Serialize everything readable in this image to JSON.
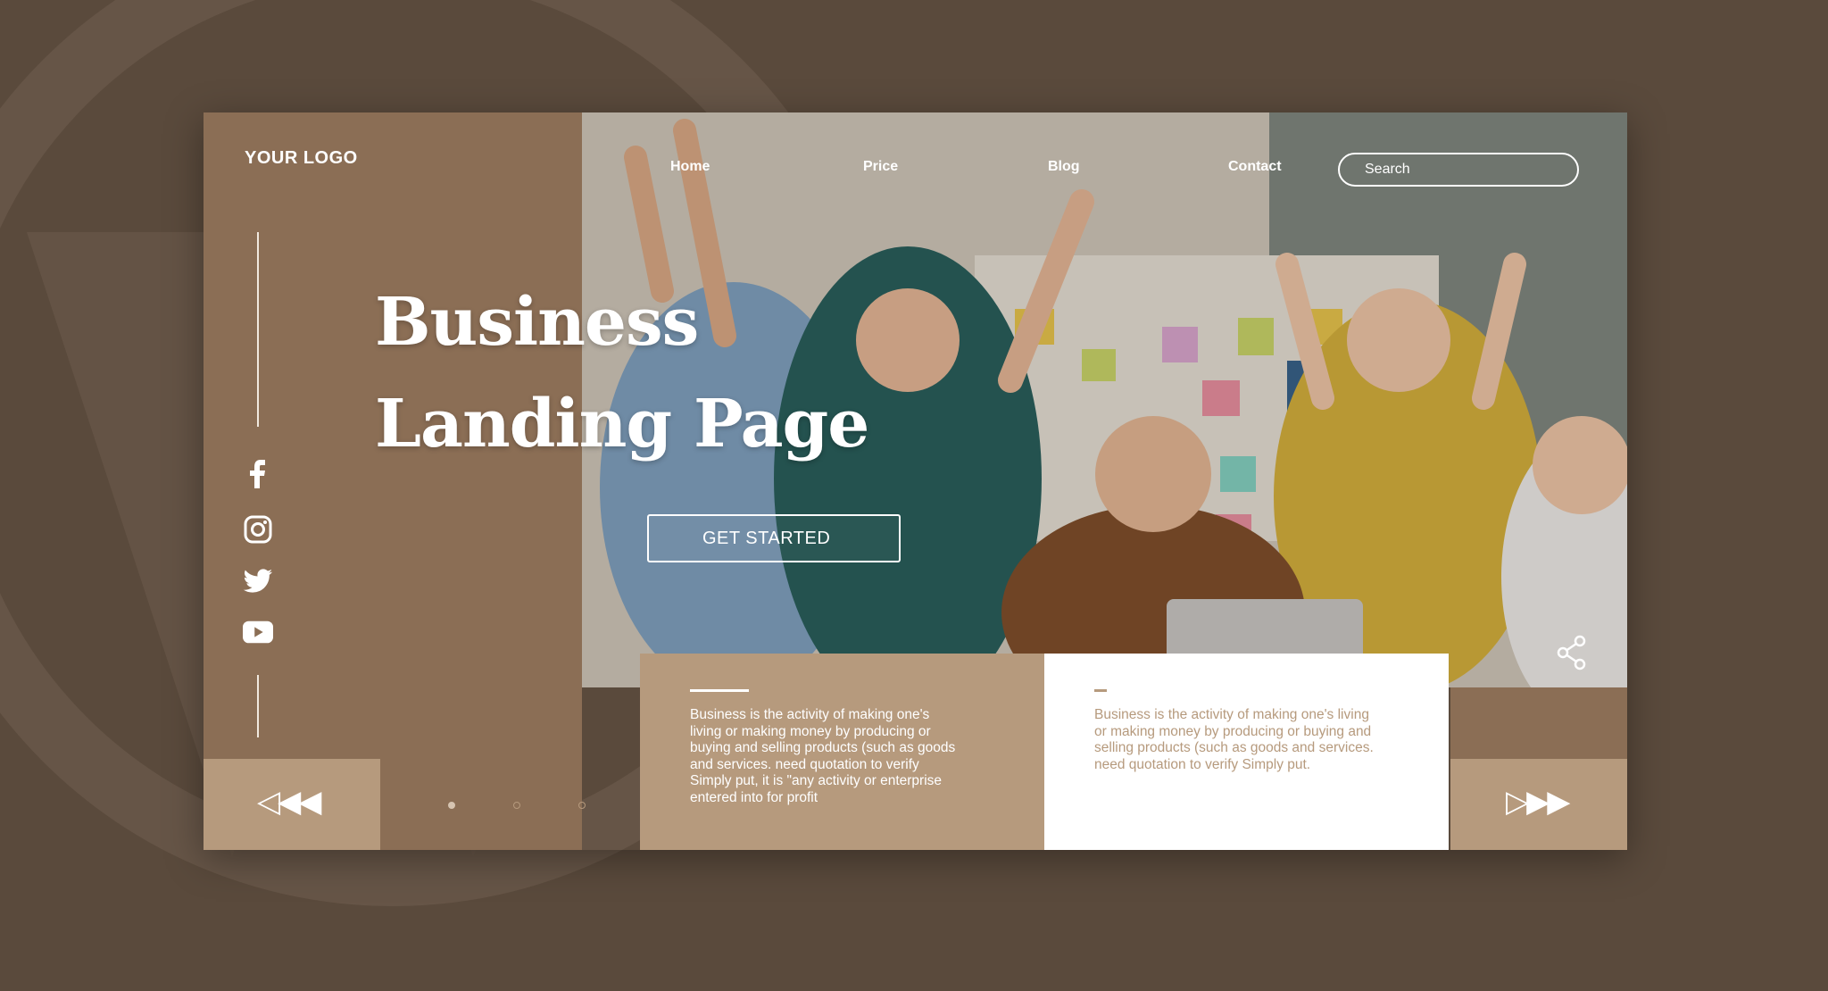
{
  "brand": {
    "logo": "YOUR LOGO"
  },
  "nav": {
    "home": "Home",
    "price": "Price",
    "blog": "Blog",
    "contact": "Contact"
  },
  "search": {
    "placeholder": "Search"
  },
  "hero": {
    "title_line1": "Business",
    "title_line2": "Landing Page",
    "cta": "GET STARTED"
  },
  "social": [
    "facebook-icon",
    "instagram-icon",
    "twitter-icon",
    "youtube-icon"
  ],
  "slider": {
    "prev": "◁◀◀",
    "next": "▷▶▶",
    "dots": 3
  },
  "cards": [
    {
      "text": "Business is the activity of making one's living or making money by producing or buying and selling products (such as goods and services. need quotation to verify Simply put, it is \"any activity or enterprise entered into for profit"
    },
    {
      "text": "Business is the activity of making one's living or making money by producing or buying and selling products (such as goods and services. need quotation to verify Simply put."
    }
  ],
  "colors": {
    "background": "#5a4a3c",
    "panel": "#8b6e55",
    "accent": "#b69a7d",
    "white": "#ffffff"
  }
}
